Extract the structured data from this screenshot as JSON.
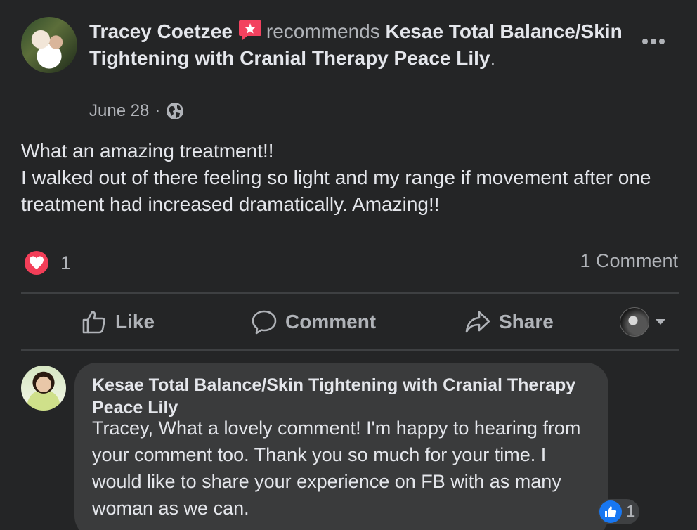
{
  "post": {
    "author": "Tracey Coetzee",
    "recommends_text": "recommends",
    "page_name": "Kesae Total Balance/Skin Tightening with Cranial Therapy Peace Lily",
    "header_end": ".",
    "date": "June 28",
    "separator": "·",
    "privacy_icon": "globe-icon",
    "more_icon": "more-options-icon",
    "body": "What an amazing treatment!!\nI walked out of there feeling so light and my range if movement after one treatment had increased dramatically.  Amazing!!"
  },
  "reactions": {
    "icon": "love-heart-icon",
    "count": "1",
    "comments_label": "1 Comment"
  },
  "actions": {
    "like_label": "Like",
    "comment_label": "Comment",
    "share_label": "Share"
  },
  "comment": {
    "author": "Kesae Total Balance/Skin Tightening with Cranial Therapy Peace Lily",
    "text": "Tracey, What a lovely comment! I'm happy to hearing from your comment too. Thank you so much for your time. I would like to share your experience on FB with as many woman as we can.",
    "reaction_icon": "like-thumb-icon",
    "reaction_count": "1"
  },
  "colors": {
    "background": "#242526",
    "text_primary": "#e4e6eb",
    "text_secondary": "#b0b3b8",
    "recommend_red": "#f3425f",
    "like_blue": "#1877f2",
    "bubble": "#3a3b3c"
  }
}
